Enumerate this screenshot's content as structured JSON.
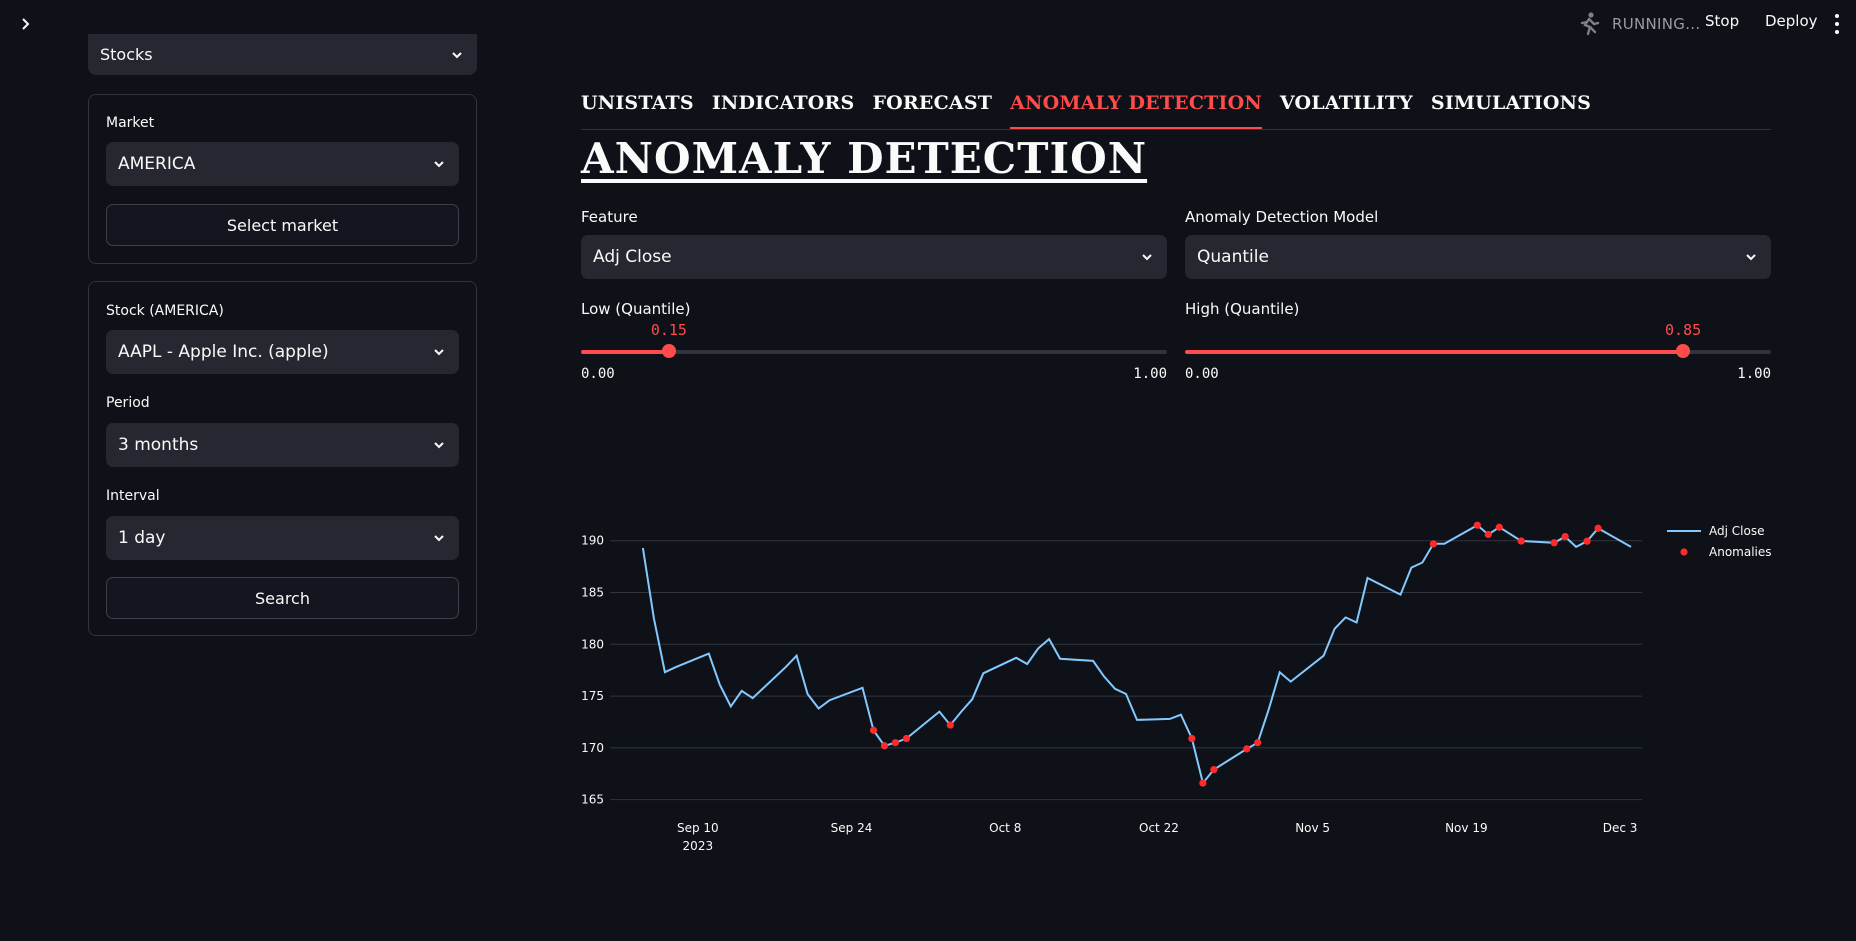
{
  "header": {
    "status_text": "RUNNING...",
    "stop_label": "Stop",
    "deploy_label": "Deploy"
  },
  "sidebar": {
    "asset_type": "Stocks",
    "market_label": "Market",
    "market_value": "AMERICA",
    "select_market_label": "Select market",
    "stock_label": "Stock (AMERICA)",
    "stock_value": "AAPL - Apple Inc. (apple)",
    "period_label": "Period",
    "period_value": "3 months",
    "interval_label": "Interval",
    "interval_value": "1 day",
    "search_label": "Search"
  },
  "tabs": [
    {
      "label": "UNISTATS",
      "active": false
    },
    {
      "label": "INDICATORS",
      "active": false
    },
    {
      "label": "FORECAST",
      "active": false
    },
    {
      "label": "ANOMALY DETECTION",
      "active": true
    },
    {
      "label": "VOLATILITY",
      "active": false
    },
    {
      "label": "SIMULATIONS",
      "active": false
    }
  ],
  "main": {
    "title": "ANOMALY DETECTION",
    "feature_label": "Feature",
    "feature_value": "Adj Close",
    "model_label": "Anomaly Detection Model",
    "model_value": "Quantile",
    "low_label": "Low (Quantile)",
    "low_value": "0.15",
    "low_fraction": 0.15,
    "low_min": "0.00",
    "low_max": "1.00",
    "high_label": "High (Quantile)",
    "high_value": "0.85",
    "high_fraction": 0.85,
    "high_min": "0.00",
    "high_max": "1.00"
  },
  "colors": {
    "accent": "#ff4b4b",
    "line": "#83c9ff",
    "anomaly": "#ff2b2b",
    "background": "#0e1117",
    "widget": "#262730"
  },
  "chart_data": {
    "type": "line",
    "ylim": [
      164,
      192
    ],
    "yticks": [
      165,
      170,
      175,
      180,
      185,
      190
    ],
    "xticks": [
      {
        "date": "2023-09-10",
        "label": "Sep 10",
        "sublabel": "2023"
      },
      {
        "date": "2023-09-24",
        "label": "Sep 24",
        "sublabel": ""
      },
      {
        "date": "2023-10-08",
        "label": "Oct 8",
        "sublabel": ""
      },
      {
        "date": "2023-10-22",
        "label": "Oct 22",
        "sublabel": ""
      },
      {
        "date": "2023-11-05",
        "label": "Nov 5",
        "sublabel": ""
      },
      {
        "date": "2023-11-19",
        "label": "Nov 19",
        "sublabel": ""
      },
      {
        "date": "2023-12-03",
        "label": "Dec 3",
        "sublabel": ""
      }
    ],
    "xrange": [
      "2023-09-02",
      "2023-12-05"
    ],
    "legend_position": "top-right",
    "series": [
      {
        "name": "Adj Close",
        "style": "line",
        "points": [
          [
            "2023-09-05",
            189.3
          ],
          [
            "2023-09-06",
            182.5
          ],
          [
            "2023-09-07",
            177.3
          ],
          [
            "2023-09-08",
            177.8
          ],
          [
            "2023-09-11",
            179.1
          ],
          [
            "2023-09-12",
            176.1
          ],
          [
            "2023-09-13",
            174.0
          ],
          [
            "2023-09-14",
            175.5
          ],
          [
            "2023-09-15",
            174.8
          ],
          [
            "2023-09-18",
            177.8
          ],
          [
            "2023-09-19",
            178.9
          ],
          [
            "2023-09-20",
            175.2
          ],
          [
            "2023-09-21",
            173.8
          ],
          [
            "2023-09-22",
            174.6
          ],
          [
            "2023-09-25",
            175.8
          ],
          [
            "2023-09-26",
            171.7
          ],
          [
            "2023-09-27",
            170.2
          ],
          [
            "2023-09-28",
            170.5
          ],
          [
            "2023-09-29",
            170.9
          ],
          [
            "2023-10-02",
            173.5
          ],
          [
            "2023-10-03",
            172.2
          ],
          [
            "2023-10-04",
            173.5
          ],
          [
            "2023-10-05",
            174.7
          ],
          [
            "2023-10-06",
            177.2
          ],
          [
            "2023-10-09",
            178.7
          ],
          [
            "2023-10-10",
            178.1
          ],
          [
            "2023-10-11",
            179.6
          ],
          [
            "2023-10-12",
            180.5
          ],
          [
            "2023-10-13",
            178.6
          ],
          [
            "2023-10-16",
            178.4
          ],
          [
            "2023-10-17",
            176.9
          ],
          [
            "2023-10-18",
            175.7
          ],
          [
            "2023-10-19",
            175.2
          ],
          [
            "2023-10-20",
            172.7
          ],
          [
            "2023-10-23",
            172.8
          ],
          [
            "2023-10-24",
            173.2
          ],
          [
            "2023-10-25",
            170.9
          ],
          [
            "2023-10-26",
            166.6
          ],
          [
            "2023-10-27",
            167.9
          ],
          [
            "2023-10-30",
            169.9
          ],
          [
            "2023-10-31",
            170.5
          ],
          [
            "2023-11-01",
            173.7
          ],
          [
            "2023-11-02",
            177.3
          ],
          [
            "2023-11-03",
            176.4
          ],
          [
            "2023-11-06",
            178.9
          ],
          [
            "2023-11-07",
            181.5
          ],
          [
            "2023-11-08",
            182.6
          ],
          [
            "2023-11-09",
            182.1
          ],
          [
            "2023-11-10",
            186.4
          ],
          [
            "2023-11-13",
            184.8
          ],
          [
            "2023-11-14",
            187.4
          ],
          [
            "2023-11-15",
            187.9
          ],
          [
            "2023-11-16",
            189.7
          ],
          [
            "2023-11-17",
            189.7
          ],
          [
            "2023-11-20",
            191.5
          ],
          [
            "2023-11-21",
            190.6
          ],
          [
            "2023-11-22",
            191.3
          ],
          [
            "2023-11-24",
            189.97
          ],
          [
            "2023-11-27",
            189.8
          ],
          [
            "2023-11-28",
            190.4
          ],
          [
            "2023-11-29",
            189.4
          ],
          [
            "2023-11-30",
            189.95
          ],
          [
            "2023-12-01",
            191.2
          ],
          [
            "2023-12-04",
            189.4
          ]
        ]
      },
      {
        "name": "Anomalies",
        "style": "markers",
        "points": [
          [
            "2023-09-26",
            171.7
          ],
          [
            "2023-09-27",
            170.2
          ],
          [
            "2023-09-28",
            170.5
          ],
          [
            "2023-09-29",
            170.9
          ],
          [
            "2023-10-03",
            172.2
          ],
          [
            "2023-10-25",
            170.9
          ],
          [
            "2023-10-26",
            166.6
          ],
          [
            "2023-10-27",
            167.9
          ],
          [
            "2023-10-30",
            169.9
          ],
          [
            "2023-10-31",
            170.5
          ],
          [
            "2023-11-16",
            189.7
          ],
          [
            "2023-11-20",
            191.5
          ],
          [
            "2023-11-21",
            190.6
          ],
          [
            "2023-11-22",
            191.3
          ],
          [
            "2023-11-24",
            189.97
          ],
          [
            "2023-11-27",
            189.8
          ],
          [
            "2023-11-28",
            190.4
          ],
          [
            "2023-11-30",
            189.95
          ],
          [
            "2023-12-01",
            191.2
          ]
        ]
      }
    ]
  }
}
